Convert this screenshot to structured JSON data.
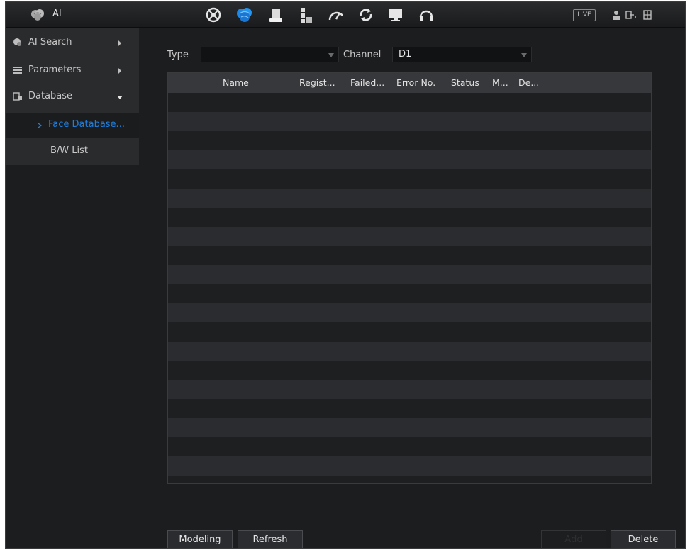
{
  "header": {
    "app_title": "AI",
    "live_label": "LIVE",
    "nav_icons": [
      "main-menu-icon",
      "ai-brain-icon",
      "storage-icon",
      "network-icon",
      "performance-icon",
      "refresh-sync-icon",
      "display-icon",
      "audio-headset-icon"
    ],
    "active_nav_index": 1
  },
  "sidebar": {
    "items": [
      {
        "label": "AI Search",
        "icon": "ai-search-icon",
        "expanded": false
      },
      {
        "label": "Parameters",
        "icon": "parameters-list-icon",
        "expanded": false
      },
      {
        "label": "Database",
        "icon": "database-icon",
        "expanded": true
      }
    ],
    "sub_items": [
      {
        "label": "Face Database...",
        "active": true
      },
      {
        "label": "B/W List",
        "active": false
      }
    ]
  },
  "filters": {
    "type_label": "Type",
    "type_value": "",
    "channel_label": "Channel",
    "channel_value": "D1"
  },
  "table": {
    "columns": [
      "Name",
      "Regist...",
      "Failed...",
      "Error No.",
      "Status",
      "M...",
      "De..."
    ],
    "rows": []
  },
  "buttons": {
    "modeling": "Modeling",
    "refresh": "Refresh",
    "add": "Add",
    "delete": "Delete"
  },
  "colors": {
    "accent": "#1f7fe0",
    "background": "#1c1d1f",
    "row_alt": "#2b2c2f"
  }
}
